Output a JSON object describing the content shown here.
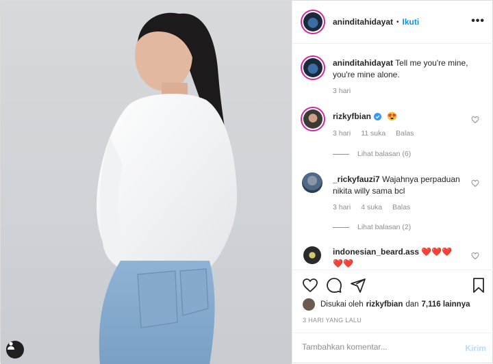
{
  "header": {
    "username": "aninditahidayat",
    "separator": "•",
    "follow_label": "Ikuti",
    "more_label": "•••"
  },
  "caption": {
    "username": "aninditahidayat",
    "text": "Tell me you're mine, you're mine alone.",
    "time": "3 hari"
  },
  "comments": [
    {
      "username": "rizkyfbian",
      "verified": true,
      "text": "😍",
      "time": "3 hari",
      "likes": "11 suka",
      "reply": "Balas",
      "view_replies": "Lihat balasan (6)"
    },
    {
      "username": "_rickyfauzi7",
      "verified": false,
      "text": "Wajahnya perpaduan nikita willy sama bcl",
      "time": "3 hari",
      "likes": "4 suka",
      "reply": "Balas",
      "view_replies": "Lihat balasan (2)"
    },
    {
      "username": "indonesian_beard.ass",
      "verified": false,
      "text": "❤️❤️❤️ ❤️❤️"
    }
  ],
  "likes": {
    "prefix": "Disukai oleh",
    "user": "rizkyfbian",
    "connector": "dan",
    "others": "7,116 lainnya"
  },
  "date": "3 HARI YANG LALU",
  "add_comment": {
    "placeholder": "Tambahkan komentar...",
    "post_label": "Kirim"
  },
  "colors": {
    "accent": "#0095f6",
    "verified": "#3897f0",
    "heart": "#ed4956",
    "post_disabled": "#b2dffc"
  },
  "icons": [
    "tag-people-icon",
    "more-options-icon",
    "heart-icon",
    "comment-icon",
    "share-icon",
    "bookmark-icon",
    "verified-badge-icon"
  ]
}
